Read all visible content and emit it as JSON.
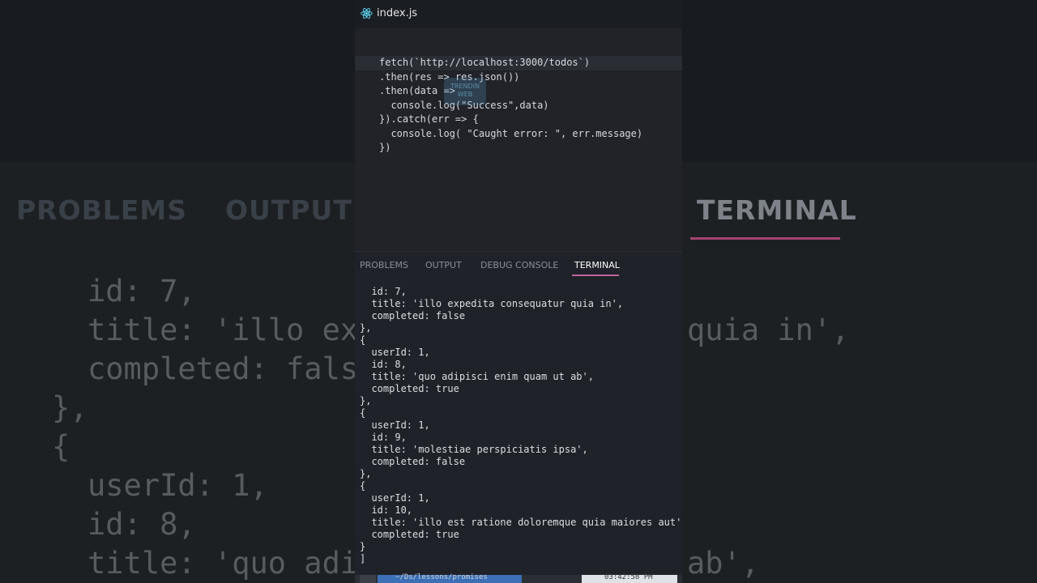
{
  "editor": {
    "file_tab": "index.js",
    "icon": "react-icon",
    "code_lines": [
      "fetch(`http://localhost:3000/todos`)",
      ".then(res => res.json())",
      ".then(data =>",
      "  console.log(\"Success\",data)",
      "}).catch(err => {",
      "  console.log( \"Caught error: \", err.message)",
      "})"
    ],
    "watermark": "TRENDIN WEB"
  },
  "panel": {
    "tabs": [
      "PROBLEMS",
      "OUTPUT",
      "DEBUG CONSOLE",
      "TERMINAL"
    ],
    "active_tab": "TERMINAL"
  },
  "terminal": {
    "lines": [
      "  id: 7,",
      "  title: 'illo expedita consequatur quia in',",
      "  completed: false",
      "},",
      "{",
      "  userId: 1,",
      "  id: 8,",
      "  title: 'quo adipisci enim quam ut ab',",
      "  completed: true",
      "},",
      "{",
      "  userId: 1,",
      "  id: 9,",
      "  title: 'molestiae perspiciatis ipsa',",
      "  completed: false",
      "},",
      "{",
      "  userId: 1,",
      "  id: 10,",
      "  title: 'illo est ratione doloremque quia maiores aut',",
      "  completed: true",
      "}",
      "]"
    ]
  },
  "statusbar": {
    "path": "~/Ds/lessons/promises",
    "time": "03:42:58 PM"
  },
  "background": {
    "tabs": [
      "PROBLEMS",
      "OUTPUT",
      "TERMINAL"
    ],
    "code_lines": [
      "id: 7,",
      "title: 'illo exp",
      "completed: fals",
      "},",
      "{",
      "userId: 1,",
      "id: 8,",
      "title: 'quo adi",
      "quia in',",
      "ab',"
    ]
  },
  "colors": {
    "accent": "#c0639c",
    "string": "#98c379",
    "number": "#e5c07b"
  }
}
